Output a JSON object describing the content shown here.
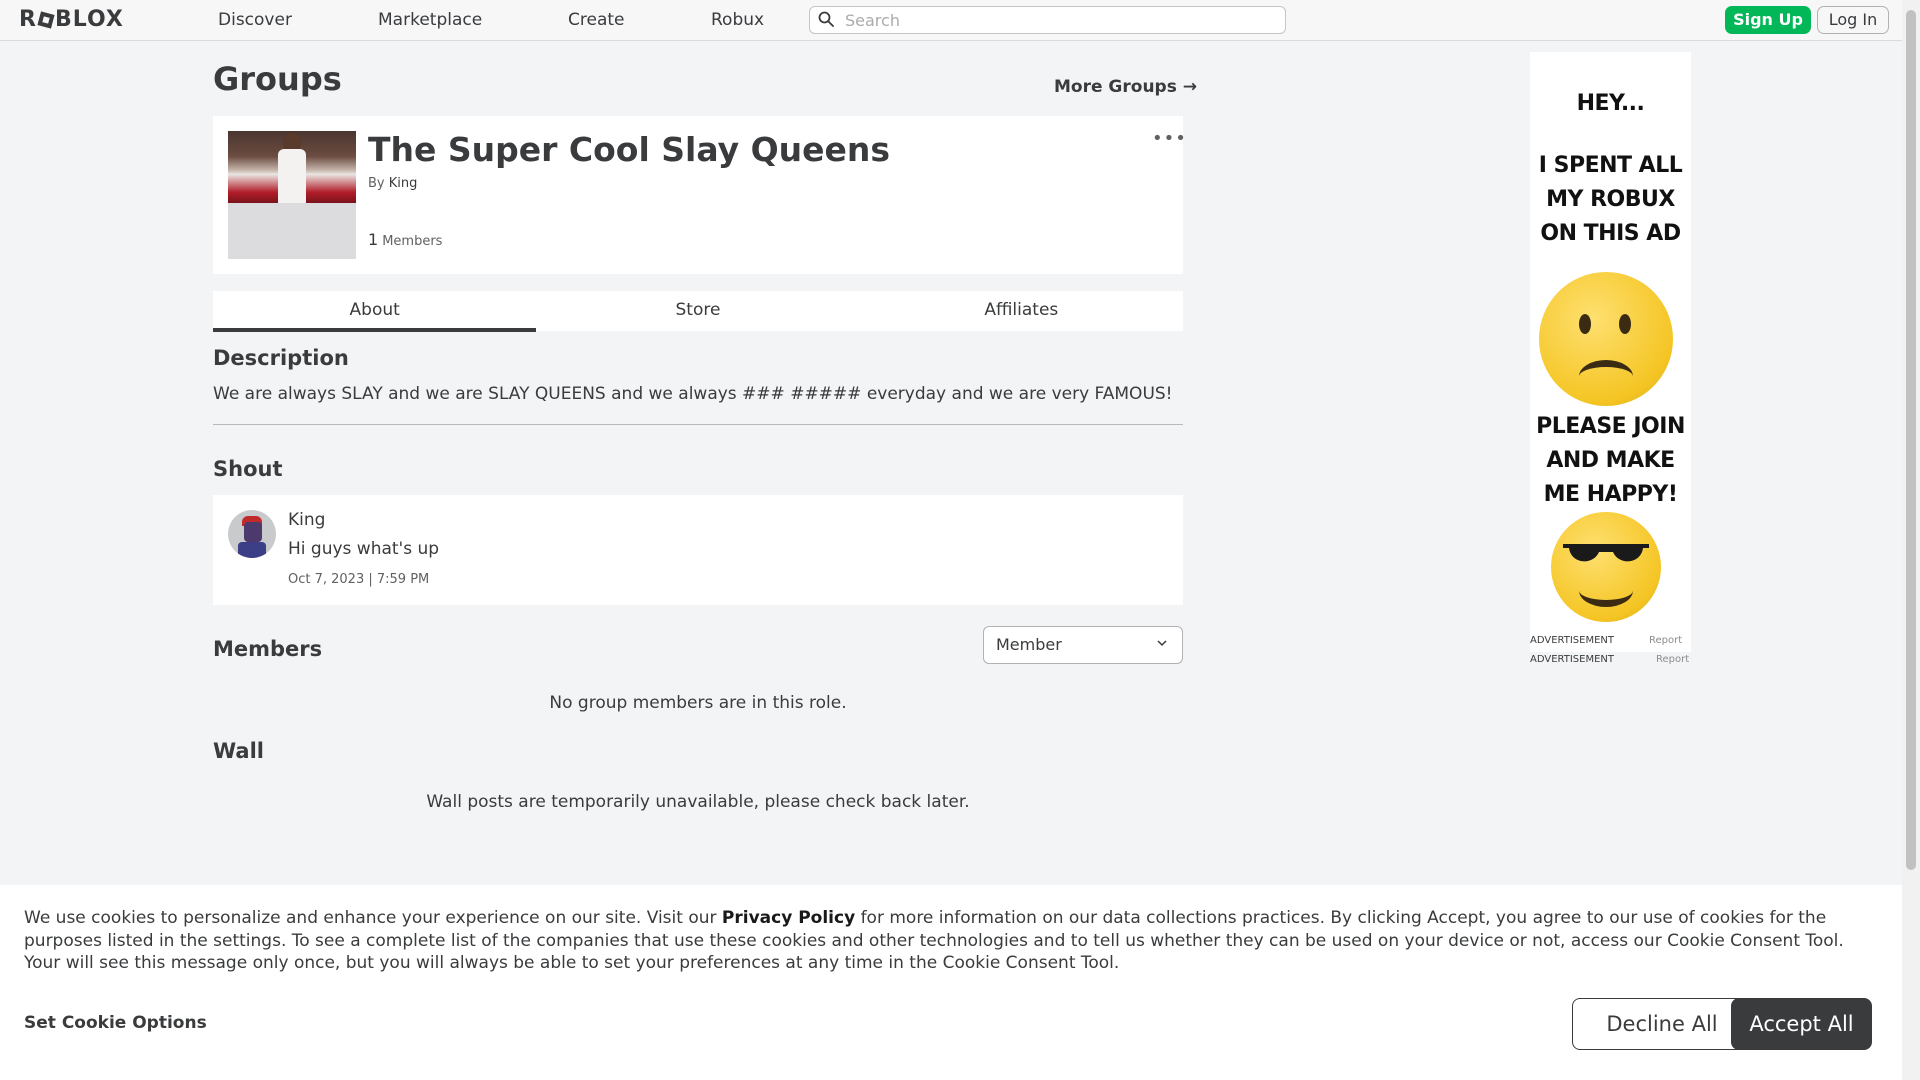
{
  "nav": {
    "logo": "ROBLOX",
    "links": [
      "Discover",
      "Marketplace",
      "Create",
      "Robux"
    ],
    "search_placeholder": "Search",
    "signup": "Sign Up",
    "login": "Log In"
  },
  "page": {
    "title": "Groups",
    "more_groups": "More Groups →"
  },
  "group": {
    "name": "The Super Cool Slay Queens",
    "by_label": "By",
    "owner": "King",
    "member_count": "1",
    "members_label": "Members",
    "menu": "•••"
  },
  "tabs": [
    {
      "label": "About",
      "active": true
    },
    {
      "label": "Store",
      "active": false
    },
    {
      "label": "Affiliates",
      "active": false
    }
  ],
  "about": {
    "description_heading": "Description",
    "description": "We are always SLAY and we are SLAY QUEENS and we always ### ##### everyday and we are very FAMOUS!",
    "shout_heading": "Shout",
    "shout": {
      "user": "King",
      "text": "Hi guys what's up",
      "date": "Oct 7, 2023 | 7:59 PM"
    },
    "members_heading": "Members",
    "role_selected": "Member",
    "no_members": "No group members are in this role.",
    "wall_heading": "Wall",
    "wall_message": "Wall posts are temporarily unavailable, please check back later."
  },
  "ad": {
    "line1": "HEY...",
    "line2": "I SPENT ALL",
    "line3": "MY ROBUX",
    "line4": "ON THIS AD",
    "line5": "PLEASE JOIN",
    "line6": "AND MAKE",
    "line7": "ME HAPPY!",
    "label": "ADVERTISEMENT",
    "report": "Report"
  },
  "cookie": {
    "text_before": "We use cookies to personalize and enhance your experience on our site. Visit our ",
    "privacy_link": "Privacy Policy",
    "text_after": " for more information on our data collections practices. By clicking Accept, you agree to our use of cookies for the purposes listed in the settings. To see a complete list of the companies that use these cookies and other technologies and to tell us whether they can be used on your device or not, access our Cookie Consent Tool. Your will see this message only once, but you will always be able to set your preferences at any time in the Cookie Consent Tool.",
    "options": "Set Cookie Options",
    "decline": "Decline All",
    "accept": "Accept All"
  },
  "colors": {
    "signup_green": "#02b757",
    "text_dark": "#393b3d",
    "page_bg": "#f2f4f5"
  }
}
